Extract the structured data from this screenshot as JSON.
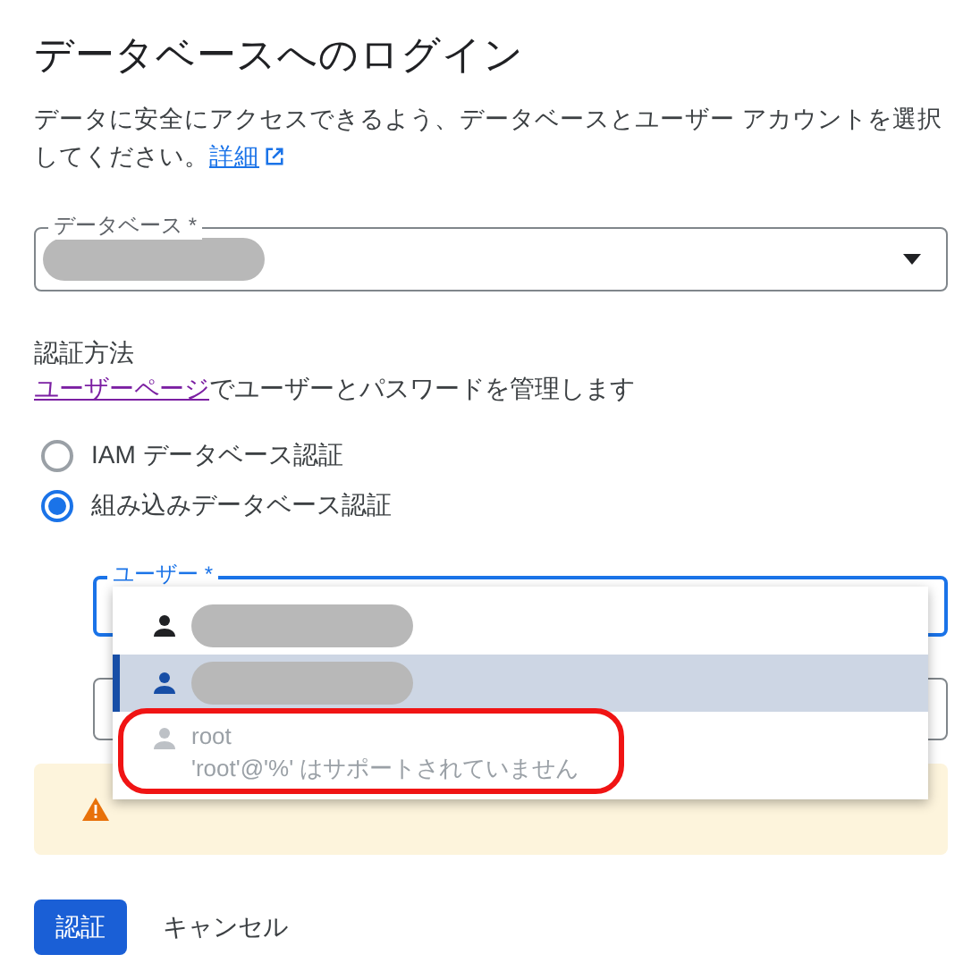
{
  "title": "データベースへのログイン",
  "description": "データに安全にアクセスできるよう、データベースとユーザー アカウントを選択してください。",
  "details_link": "詳細",
  "database_field": {
    "label": "データベース *",
    "value_redacted": true
  },
  "auth": {
    "heading": "認証方法",
    "link": "ユーザーページ",
    "hint": "でユーザーとパスワードを管理します",
    "options": [
      {
        "label": "IAM データベース認証",
        "selected": false
      },
      {
        "label": "組み込みデータベース認証",
        "selected": true
      }
    ]
  },
  "user_field": {
    "label": "ユーザー *",
    "focused": true
  },
  "user_menu": {
    "items": [
      {
        "kind": "redacted",
        "selected": false,
        "disabled": false,
        "circled": false
      },
      {
        "kind": "redacted",
        "selected": true,
        "disabled": false,
        "circled": false
      },
      {
        "kind": "user",
        "name": "root",
        "note": "'root'@'%' はサポートされていません",
        "selected": false,
        "disabled": true,
        "circled": true
      }
    ]
  },
  "warning": {
    "kind": "warning"
  },
  "buttons": [
    {
      "label": "認証",
      "kind": "primary"
    },
    {
      "label": "キャンセル",
      "kind": "text"
    }
  ]
}
